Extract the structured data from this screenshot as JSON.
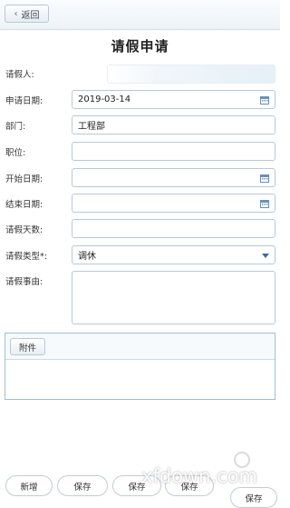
{
  "header": {
    "back_label": "返回"
  },
  "title": "请假申请",
  "form": {
    "applicant_label": "请假人:",
    "apply_date_label": "申请日期:",
    "apply_date_value": "2019-03-14",
    "department_label": "部门:",
    "department_value": "工程部",
    "position_label": "职位:",
    "position_value": "",
    "start_date_label": "开始日期:",
    "end_date_label": "结束日期:",
    "days_label": "请假天数:",
    "type_label": "请假类型*:",
    "type_value": "调休",
    "reason_label": "请假事由:"
  },
  "attachment": {
    "button_label": "附件"
  },
  "bottom_bar": {
    "new_label": "新增",
    "save1_label": "保存",
    "save2_label": "保存",
    "save3_label": "保存",
    "save4_label": "保存"
  },
  "watermark": "xfdown.com",
  "colors": {
    "border": "#b8c8d8",
    "accent": "#3b6aa0",
    "topbar": "#eef3f8"
  }
}
